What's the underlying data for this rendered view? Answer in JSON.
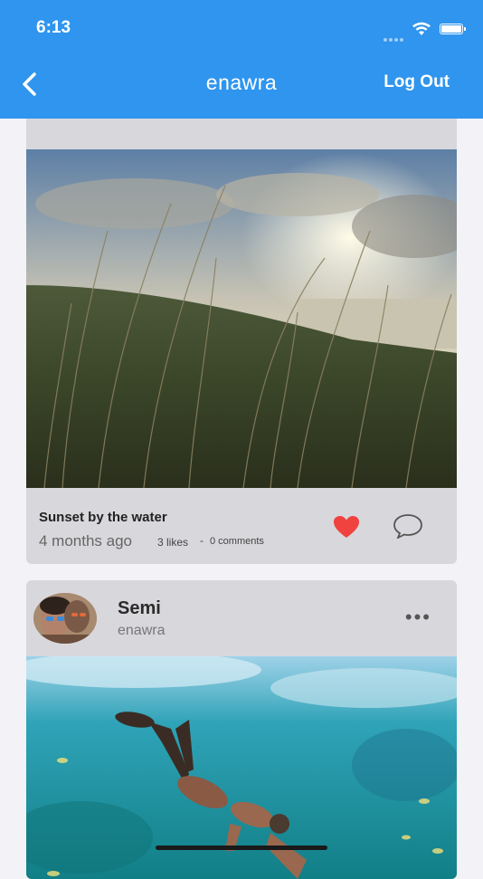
{
  "status_bar": {
    "time": "6:13"
  },
  "nav": {
    "title": "enawra",
    "logout_label": "Log Out"
  },
  "posts": [
    {
      "author_name": "",
      "username": "enawra",
      "caption": "Sunset by the water",
      "time_ago": "4 months ago",
      "likes": "3 likes",
      "separator": "-",
      "comments": "0 comments",
      "liked": true
    },
    {
      "author_name": "Semi",
      "username": "enawra",
      "more_label": "•••"
    }
  ],
  "colors": {
    "header": "#2f95ee",
    "heart": "#f0423f",
    "card": "#d8d8dc"
  },
  "icons": [
    "back-chevron-icon",
    "wifi-icon",
    "battery-icon",
    "heart-icon",
    "comment-bubble-icon",
    "more-dots-icon"
  ]
}
